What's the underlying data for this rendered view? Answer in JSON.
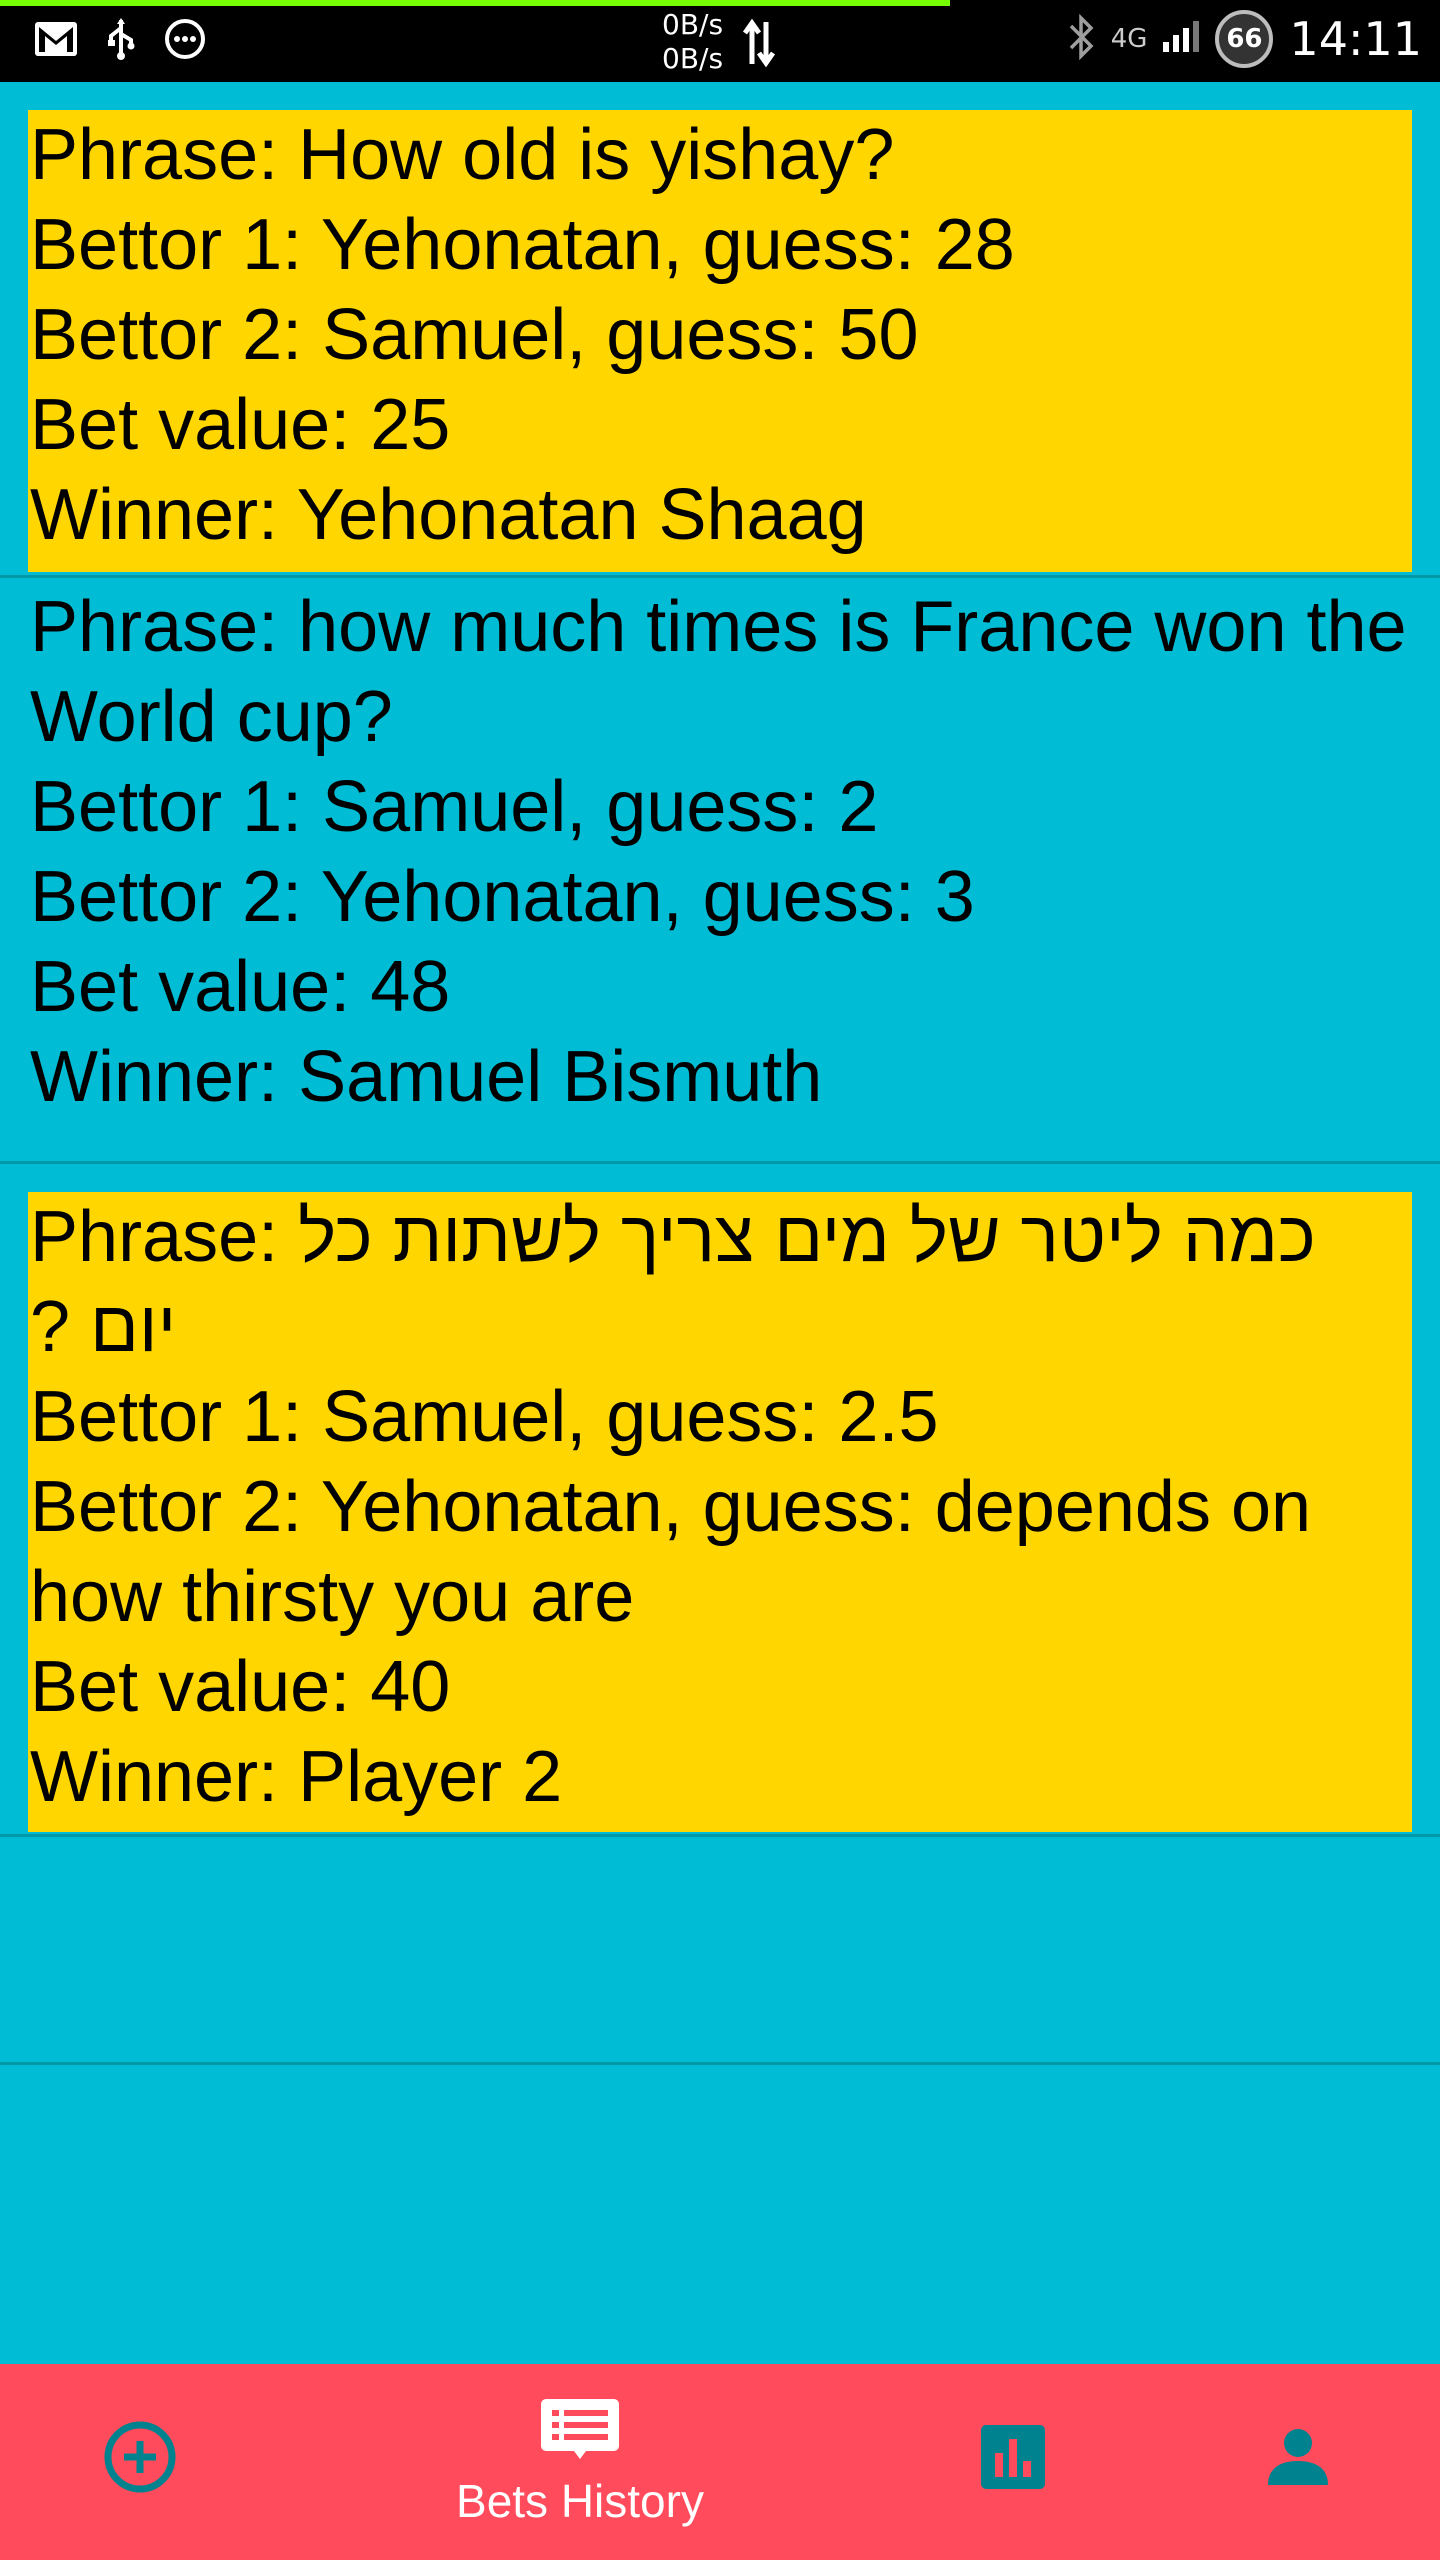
{
  "status_bar": {
    "speed_up": "0B/s",
    "speed_down": "0B/s",
    "network": "4G",
    "battery": "66",
    "time": "14:11",
    "icons": [
      "gmail-icon",
      "usb-icon",
      "more-dots-icon",
      "data-arrows-icon",
      "bluetooth-icon",
      "signal-icon",
      "battery-icon"
    ]
  },
  "bets": [
    {
      "phrase_label": "Phrase: ",
      "phrase": "How old is yishay?",
      "bettor1": "Bettor 1: Yehonatan, guess: 28",
      "bettor2": "Bettor 2: Samuel, guess: 50",
      "bet_value": "Bet value: 25",
      "winner": "Winner: Yehonatan Shaag"
    },
    {
      "phrase_label": "Phrase: ",
      "phrase": "how much times is France won the World cup?",
      "bettor1": "Bettor 1: Samuel, guess: 2",
      "bettor2": "Bettor 2: Yehonatan, guess: 3",
      "bet_value": "Bet value: 48",
      "winner": "Winner: Samuel Bismuth"
    },
    {
      "phrase_label": "Phrase: ",
      "phrase": "כמה ליטר של מים צריך לשתות כל יום ?",
      "bettor1": "Bettor 1: Samuel, guess: 2.5",
      "bettor2": "Bettor 2: Yehonatan, guess: depends on how thirsty you are",
      "bet_value": "Bet value: 40",
      "winner": "Winner: Player 2"
    }
  ],
  "bottom_nav": {
    "items": [
      {
        "icon": "add-circle-icon",
        "label": ""
      },
      {
        "icon": "bets-history-icon",
        "label": "Bets History"
      },
      {
        "icon": "bar-chart-icon",
        "label": ""
      },
      {
        "icon": "person-icon",
        "label": ""
      }
    ]
  },
  "colors": {
    "background": "#00BCD4",
    "card_highlight": "#FFD600",
    "nav_background": "#FF4B5C",
    "nav_icon_inactive": "#00838F",
    "nav_icon_active": "#FFFFFF",
    "status_progress": "#76FF03"
  }
}
